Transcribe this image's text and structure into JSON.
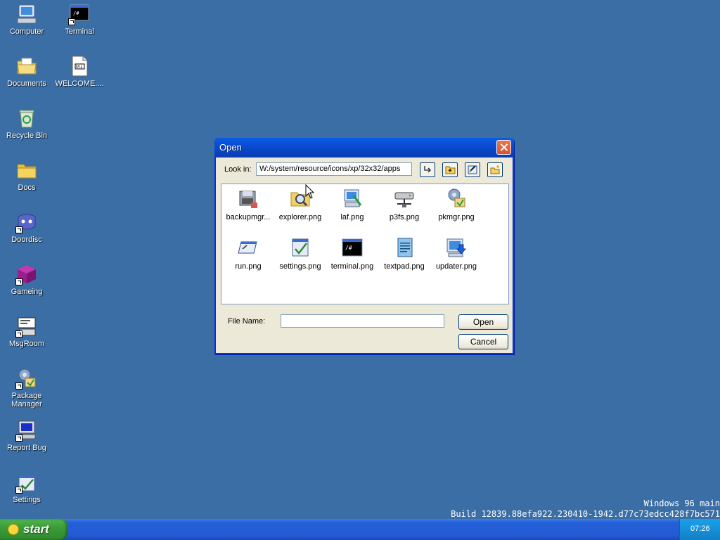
{
  "desktop": {
    "icons": [
      {
        "label": "Computer",
        "icon": "computer-icon"
      },
      {
        "label": "Terminal",
        "icon": "terminal-icon"
      },
      {
        "label": "Documents",
        "icon": "documents-folder-icon"
      },
      {
        "label": "WELCOME....",
        "icon": "markdown-file-icon"
      },
      {
        "label": "Recycle Bin",
        "icon": "recycle-bin-icon"
      },
      {
        "label": "Docs",
        "icon": "folder-icon"
      },
      {
        "label": "Doordisc",
        "icon": "doordisc-icon"
      },
      {
        "label": "Gameing",
        "icon": "gaming-cube-icon"
      },
      {
        "label": "MsgRoom",
        "icon": "msgroom-icon"
      },
      {
        "label": "Package Manager",
        "icon": "package-manager-icon"
      },
      {
        "label": "Report Bug",
        "icon": "report-bug-icon"
      },
      {
        "label": "Settings",
        "icon": "settings-icon"
      }
    ]
  },
  "dialog": {
    "title": "Open",
    "look_in_label": "Look in:",
    "path": "W:/system/resource/icons/xp/32x32/apps",
    "toolbar": [
      "go-up-icon",
      "parent-folder-icon",
      "edit-icon",
      "new-folder-icon"
    ],
    "files": [
      {
        "name": "backupmgr...",
        "icon": "backup-manager-icon"
      },
      {
        "name": "explorer.png",
        "icon": "explorer-icon"
      },
      {
        "name": "laf.png",
        "icon": "laf-icon"
      },
      {
        "name": "p3fs.png",
        "icon": "p3fs-icon"
      },
      {
        "name": "pkmgr.png",
        "icon": "package-manager-icon"
      },
      {
        "name": "run.png",
        "icon": "run-icon"
      },
      {
        "name": "settings.png",
        "icon": "settings-icon"
      },
      {
        "name": "terminal.png",
        "icon": "terminal-icon"
      },
      {
        "name": "textpad.png",
        "icon": "textpad-icon"
      },
      {
        "name": "updater.png",
        "icon": "updater-icon"
      }
    ],
    "file_name_label": "File Name:",
    "file_name_value": "",
    "open_label": "Open",
    "cancel_label": "Cancel"
  },
  "build_info": {
    "line1": "Windows 96 main",
    "line2": "Build 12839.88efa922.230410-1942.d77c73edcc428f7bc571"
  },
  "taskbar": {
    "start_label": "start",
    "clock": "07:26"
  },
  "colors": {
    "desktop": "#3a6ea5",
    "taskbar": "#225ad2",
    "start_button": "#3c9c39",
    "dialog_title": "#0a4fd6",
    "dialog_body": "#ece9d8"
  }
}
